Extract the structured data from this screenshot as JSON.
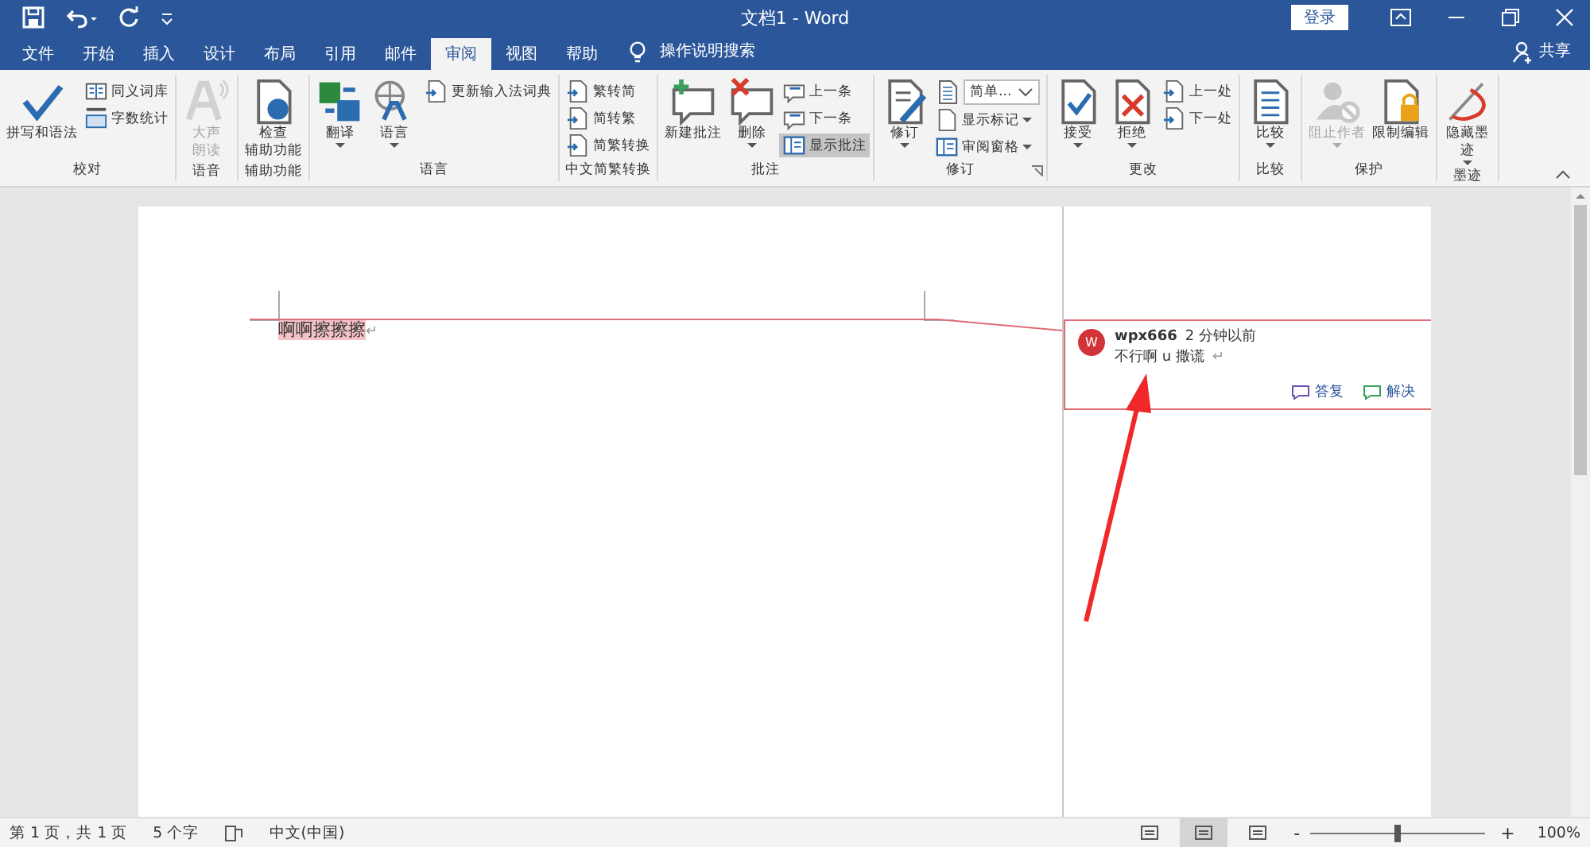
{
  "window": {
    "title": "文档1  -  Word",
    "login": "登录"
  },
  "tabs": [
    {
      "label": "文件",
      "selected": false
    },
    {
      "label": "开始",
      "selected": false
    },
    {
      "label": "插入",
      "selected": false
    },
    {
      "label": "设计",
      "selected": false
    },
    {
      "label": "布局",
      "selected": false
    },
    {
      "label": "引用",
      "selected": false
    },
    {
      "label": "邮件",
      "selected": false
    },
    {
      "label": "审阅",
      "selected": true
    },
    {
      "label": "视图",
      "selected": false
    },
    {
      "label": "帮助",
      "selected": false
    }
  ],
  "tell_me": {
    "label": "操作说明搜索"
  },
  "share": {
    "label": "共享"
  },
  "ribbon": {
    "groups": [
      {
        "name": "校对",
        "items": [
          {
            "kind": "large",
            "label": "拼写和语法"
          },
          {
            "kind": "small",
            "label": "同义词库"
          },
          {
            "kind": "small",
            "label": "字数统计"
          }
        ]
      },
      {
        "name": "语音",
        "items": [
          {
            "kind": "large",
            "lines": [
              "大声",
              "朗读"
            ],
            "disabled": true
          }
        ]
      },
      {
        "name": "辅助功能",
        "items": [
          {
            "kind": "large",
            "lines": [
              "检查",
              "辅助功能"
            ]
          }
        ]
      },
      {
        "name": "语言",
        "items": [
          {
            "kind": "large",
            "label": "翻译",
            "dropdown": true
          },
          {
            "kind": "large",
            "label": "语言",
            "dropdown": true
          },
          {
            "kind": "small",
            "label": "更新输入法词典"
          }
        ]
      },
      {
        "name": "中文简繁转换",
        "items": [
          {
            "kind": "small",
            "label": "繁转简"
          },
          {
            "kind": "small",
            "label": "简转繁"
          },
          {
            "kind": "small",
            "label": "简繁转换"
          }
        ]
      },
      {
        "name": "批注",
        "items": [
          {
            "kind": "large",
            "label": "新建批注"
          },
          {
            "kind": "large",
            "label": "删除",
            "dropdown": true
          },
          {
            "kind": "small",
            "label": "上一条"
          },
          {
            "kind": "small",
            "label": "下一条"
          },
          {
            "kind": "toggle",
            "label": "显示批注",
            "on": true
          }
        ]
      },
      {
        "name": "修订",
        "launcher": true,
        "items": [
          {
            "kind": "large",
            "label": "修订",
            "dropdown": true
          },
          {
            "kind": "combo",
            "label": "简单..."
          },
          {
            "kind": "small",
            "label": "显示标记",
            "dropdown": true
          },
          {
            "kind": "small",
            "label": "审阅窗格",
            "dropdown": true
          }
        ]
      },
      {
        "name": "更改",
        "items": [
          {
            "kind": "large",
            "label": "接受",
            "dropdown": true
          },
          {
            "kind": "large",
            "label": "拒绝",
            "dropdown": true
          },
          {
            "kind": "small",
            "label": "上一处"
          },
          {
            "kind": "small",
            "label": "下一处"
          }
        ]
      },
      {
        "name": "比较",
        "items": [
          {
            "kind": "large",
            "label": "比较",
            "dropdown": true
          }
        ]
      },
      {
        "name": "保护",
        "items": [
          {
            "kind": "large",
            "label": "阻止作者",
            "dropdown": true,
            "disabled": true
          },
          {
            "kind": "large",
            "label": "限制编辑"
          }
        ]
      },
      {
        "name": "墨迹",
        "items": [
          {
            "kind": "large",
            "lines": [
              "隐藏墨",
              "迹"
            ],
            "dropdown": true
          }
        ]
      }
    ]
  },
  "document": {
    "text": "啊啊擦擦擦",
    "mark": "↵"
  },
  "comment": {
    "avatar": "W",
    "author": "wpx666",
    "time": "2 分钟以前",
    "text": "不行啊 u 撒谎",
    "mark": "↵",
    "actions": [
      "答复",
      "解决"
    ]
  },
  "status_bar": {
    "page": "第 1 页，共 1 页",
    "words": "5 个字",
    "language": "中文(中国)",
    "views": [
      {
        "selected": false
      },
      {
        "selected": true
      },
      {
        "selected": false
      }
    ],
    "zoom": {
      "minus": "-",
      "plus": "+",
      "level": 0.5,
      "reading": "100%"
    }
  }
}
